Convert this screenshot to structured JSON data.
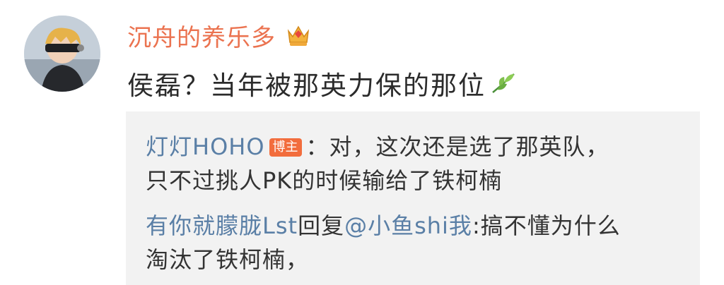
{
  "comment": {
    "username": "沉舟的养乐多",
    "text": "侯磊？当年被那英力保的那位",
    "crown_icon": "crown-icon",
    "leaf_icon": "leaf-icon"
  },
  "replies": [
    {
      "author": "灯灯HOHO",
      "badge": "博主",
      "separator": "：",
      "line1": "对，这次还是选了那英队，",
      "line2": "只不过挑人PK的时候输给了铁柯楠"
    },
    {
      "author": "有你就朦胧Lst",
      "reply_word": "回复",
      "mention": "@小鱼shi我",
      "line1": ":搞不懂为什么",
      "line2": "淘汰了铁柯楠，"
    }
  ],
  "colors": {
    "username": "#eb7350",
    "link": "#5a7fa6",
    "badge": "#f26d3d",
    "reply_bg": "#f2f2f2"
  }
}
